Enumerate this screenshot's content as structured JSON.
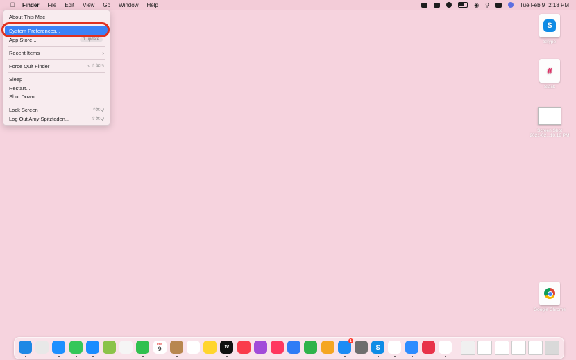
{
  "menubar": {
    "apple_icon": "apple-logo-icon",
    "items": [
      "Finder",
      "File",
      "Edit",
      "View",
      "Go",
      "Window",
      "Help"
    ],
    "status_icons": [
      "zoom-icon",
      "pen-icon",
      "checkbox-icon",
      "battery-icon",
      "wifi-icon",
      "search-icon",
      "control-center-icon",
      "siri-icon"
    ],
    "date": "Tue Feb 9",
    "time": "2:18 PM"
  },
  "apple_menu": {
    "items": [
      {
        "label": "About This Mac",
        "shortcut": ""
      },
      {
        "label": "System Preferences...",
        "shortcut": "",
        "highlighted": true
      },
      {
        "label": "App Store...",
        "badge": "1 update"
      },
      {
        "label": "Recent Items",
        "submenu": true
      },
      {
        "label": "Force Quit Finder",
        "shortcut": "⌥⇧⌘⎋"
      },
      {
        "label": "Sleep",
        "shortcut": ""
      },
      {
        "label": "Restart...",
        "shortcut": ""
      },
      {
        "label": "Shut Down...",
        "shortcut": ""
      },
      {
        "label": "Lock Screen",
        "shortcut": "^⌘Q"
      },
      {
        "label": "Log Out Amy Spitzfaden...",
        "shortcut": "⇧⌘Q"
      }
    ],
    "submenu_glyph": "›"
  },
  "desktop": {
    "icons": [
      {
        "label": "Skype",
        "icon": "skype-icon"
      },
      {
        "label": "Slack",
        "icon": "slack-icon"
      },
      {
        "label_line1": "Screen Shot",
        "label_line2": "2021-02...18.19 PM",
        "icon": "screenshot-file-icon"
      },
      {
        "label": "Google Chrome",
        "icon": "chrome-icon"
      }
    ]
  },
  "dock": {
    "calendar_day": "9",
    "calendar_month": "FEB",
    "appletv_label": "tv",
    "appstore_badge": "1",
    "apps": [
      {
        "name": "finder-icon",
        "color": "#1e88e5"
      },
      {
        "name": "launchpad-icon",
        "color": "#e8e8e8"
      },
      {
        "name": "safari-icon",
        "color": "#1e90ff"
      },
      {
        "name": "messages-icon",
        "color": "#34c759"
      },
      {
        "name": "mail-icon",
        "color": "#1a8cff"
      },
      {
        "name": "maps-icon",
        "color": "#8bc34a"
      },
      {
        "name": "photos-icon",
        "color": "#f5f5f5"
      },
      {
        "name": "facetime-icon",
        "color": "#30c04f"
      },
      {
        "name": "calendar-icon",
        "color": "#ffffff"
      },
      {
        "name": "contacts-icon",
        "color": "#b8874f"
      },
      {
        "name": "reminders-icon",
        "color": "#ffffff"
      },
      {
        "name": "notes-icon",
        "color": "#ffd52e"
      },
      {
        "name": "appletv-icon",
        "color": "#111111"
      },
      {
        "name": "music-icon",
        "color": "#fa3c4c"
      },
      {
        "name": "podcasts-icon",
        "color": "#a24bd9"
      },
      {
        "name": "news-icon",
        "color": "#ff375f"
      },
      {
        "name": "keynote-icon",
        "color": "#2f7cf6"
      },
      {
        "name": "numbers-icon",
        "color": "#2fb34b"
      },
      {
        "name": "pages-icon",
        "color": "#f5a623"
      },
      {
        "name": "appstore-icon",
        "color": "#1c8cf5"
      },
      {
        "name": "system-preferences-icon",
        "color": "#6e6e6e"
      },
      {
        "name": "skype-icon",
        "color": "#0f8ce6"
      },
      {
        "name": "slack-icon",
        "color": "#ffffff"
      },
      {
        "name": "zoom-icon",
        "color": "#2d8cff"
      },
      {
        "name": "airmail-icon",
        "color": "#e8334a"
      },
      {
        "name": "chrome-icon",
        "color": "#ffffff"
      },
      {
        "name": "downloads-icon",
        "color": "#f0f0f0"
      },
      {
        "name": "doc-thumb-icon",
        "color": "#ffffff"
      },
      {
        "name": "doc-thumb-icon",
        "color": "#ffffff"
      },
      {
        "name": "doc-thumb-icon",
        "color": "#ffffff"
      },
      {
        "name": "doc-thumb-icon",
        "color": "#ffffff"
      },
      {
        "name": "trash-icon",
        "color": "#d9d9d9"
      }
    ]
  },
  "colors": {
    "desktop": "#f6d3de",
    "highlight": "#3b82f6",
    "annotation_ring": "#e0301e"
  }
}
